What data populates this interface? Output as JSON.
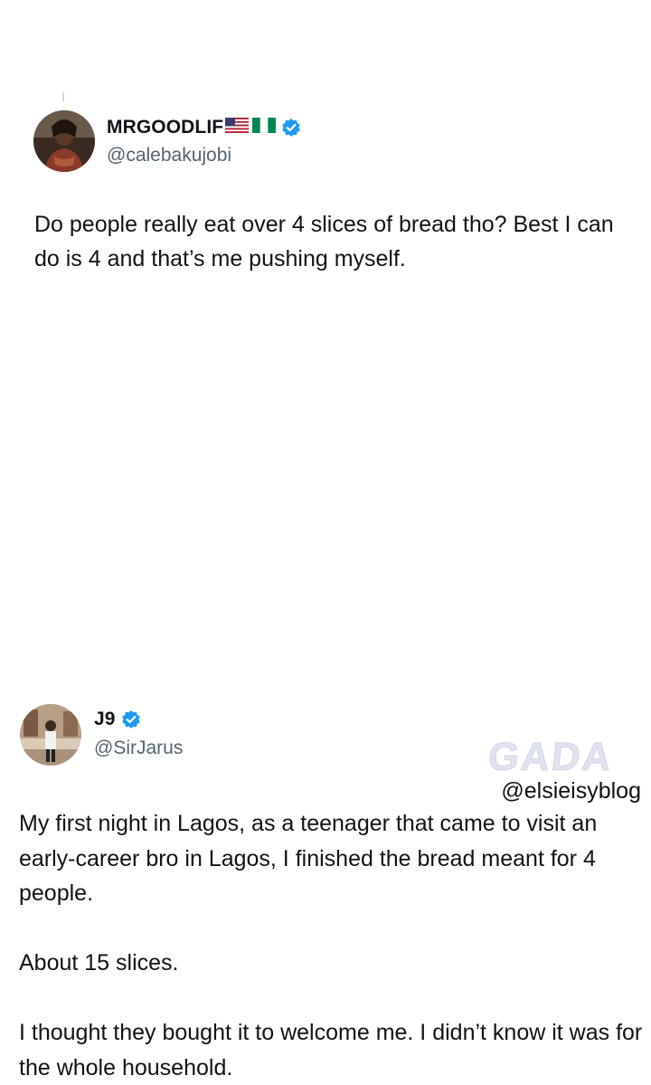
{
  "tweets": [
    {
      "display_name": "MRGOODLIF",
      "flags": [
        "us-flag",
        "nigeria-flag"
      ],
      "verified": true,
      "handle": "@calebakujobi",
      "text": "Do people really eat over 4 slices of bread tho? Best I can do is 4 and that’s me pushing myself."
    },
    {
      "display_name": "J9",
      "verified": true,
      "handle": "@SirJarus",
      "text": "My first night in Lagos, as a teenager that came to visit an early-career bro in Lagos, I finished the bread meant for 4 people.\n\nAbout 15 slices.\n\nI thought they bought it to welcome me. I didn’t know it was for the whole household."
    }
  ],
  "watermark": {
    "logo_text": "GADA",
    "handle": "@elsieisyblog"
  },
  "colors": {
    "verified_blue": "#1d9bf0",
    "handle_gray": "#536471",
    "text": "#0f1419"
  }
}
